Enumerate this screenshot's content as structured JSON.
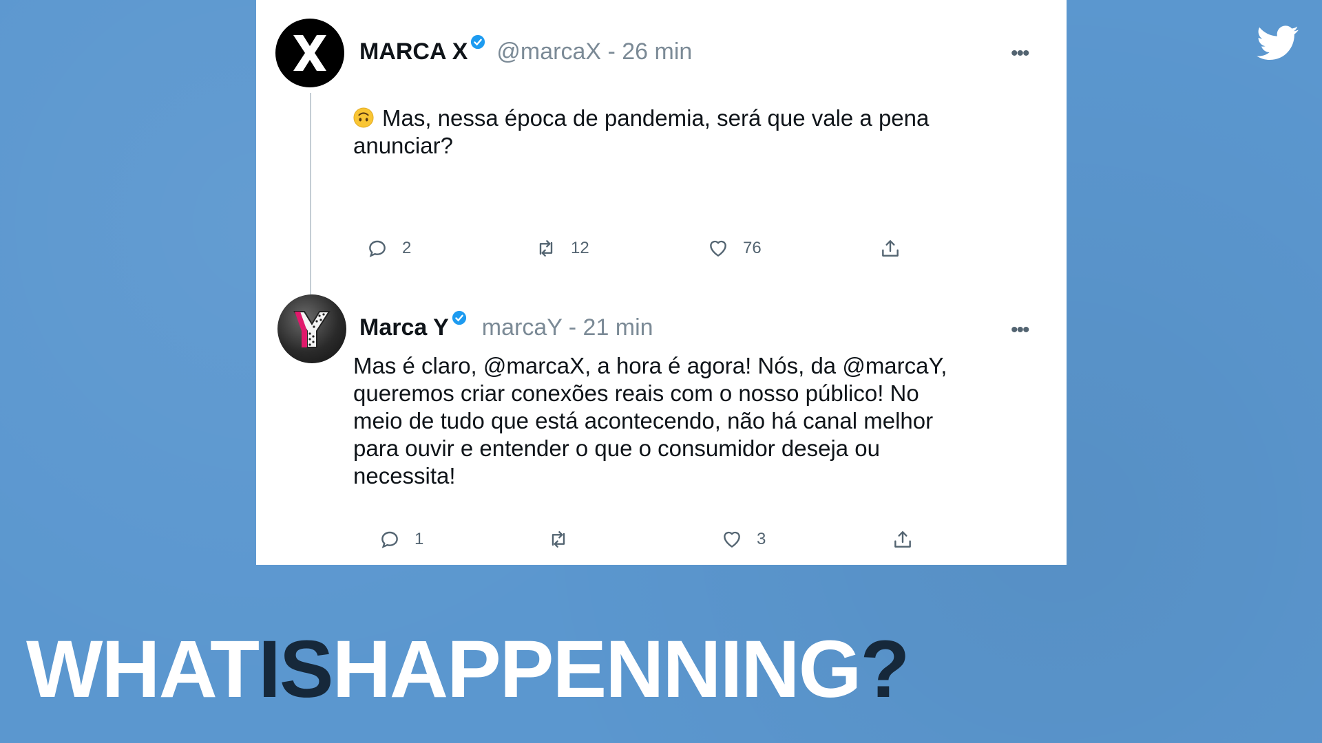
{
  "brand_icon": "twitter-bird-icon",
  "tweets": [
    {
      "avatar_letter": "X",
      "name": "MARCA X",
      "verified": true,
      "handle_time": "@marcaX - 26 min",
      "text": "Mas, nessa época de pandemia, será que vale a pena anunciar?",
      "emoji": "upside-down-face",
      "reply_count": "2",
      "retweet_count": "12",
      "like_count": "76"
    },
    {
      "avatar_letter": "Y",
      "name": "Marca Y",
      "verified": true,
      "handle_time": "marcaY - 21 min",
      "text": "Mas é claro, @marcaX, a hora é agora! Nós, da @marcaY, queremos criar conexões reais com o nosso público! No meio de tudo que está acontecendo, não há canal melhor para ouvir e entender o que o consumidor deseja ou necessita!",
      "reply_count": "1",
      "retweet_count": "",
      "like_count": "3"
    }
  ],
  "footer": {
    "part1": "WHAT",
    "part2": "IS",
    "part3": "HAPPENNING",
    "part4": "?"
  },
  "colors": {
    "background": "#5b97cf",
    "verified": "#1d9bf0",
    "accent_dark": "#16283a",
    "magenta": "#e0196b"
  }
}
